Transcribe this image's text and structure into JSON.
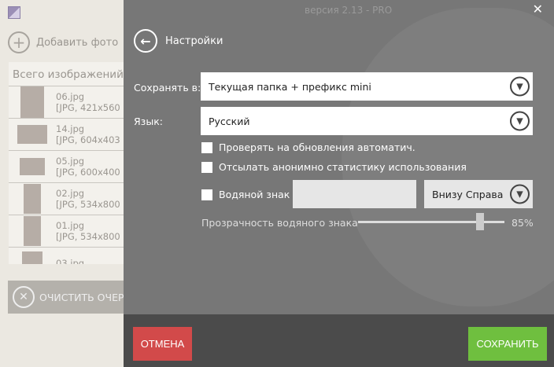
{
  "window": {
    "title": "версия 2.13 - PRO"
  },
  "sidebar": {
    "add_label": "Добавить фото",
    "list_header": "Всего изображений",
    "items": [
      {
        "name": "06.jpg",
        "info": "[JPG, 421x560"
      },
      {
        "name": "14.jpg",
        "info": "[JPG, 604x403"
      },
      {
        "name": "05.jpg",
        "info": "[JPG, 600x400"
      },
      {
        "name": "02.jpg",
        "info": "[JPG, 534x800"
      },
      {
        "name": "01.jpg",
        "info": "[JPG, 534x800"
      },
      {
        "name": "03.jpg",
        "info": ""
      }
    ],
    "clear_label": "ОЧИСТИТЬ ОЧЕР"
  },
  "settings": {
    "title": "Настройки",
    "save_to_label": "Сохранять в:",
    "save_to_value": "Текущая папка + префикс mini",
    "language_label": "Язык:",
    "language_value": "Русский",
    "check_updates": "Проверять на обновления автоматич.",
    "send_stats": "Отсылать анонимно статистику использования",
    "watermark_label": "Водяной знак",
    "watermark_text": "",
    "watermark_position": "Внизу Справа",
    "opacity_label": "Прозрачность водяного знака",
    "opacity_value": "85%",
    "opacity_fraction": 0.85
  },
  "footer": {
    "cancel": "ОТМЕНА",
    "save": "СОХРАНИТЬ"
  },
  "colors": {
    "cancel": "#d24a4a",
    "save": "#6fbf3f"
  }
}
